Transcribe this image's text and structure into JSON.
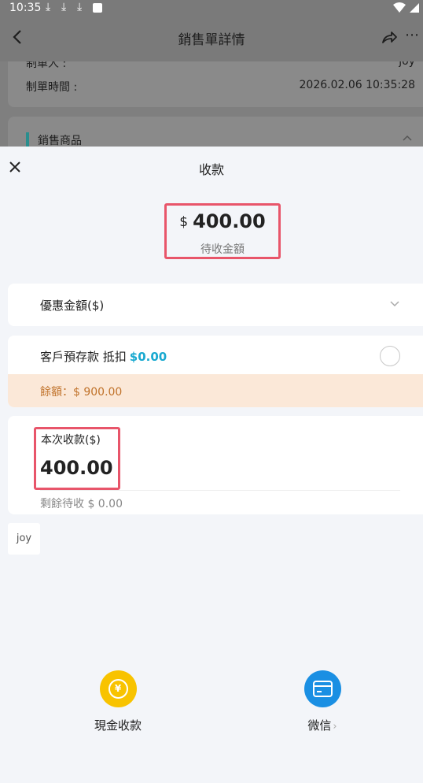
{
  "status_bar": {
    "time": "10:35"
  },
  "navbar": {
    "title": "銷售單詳情",
    "more": "⋯"
  },
  "background": {
    "creator_label": "制單人 :",
    "creator_value": "joy",
    "time_label": "制單時間 :",
    "time_value": "2026.02.06 10:35:28",
    "section_title": "銷售商品"
  },
  "sheet": {
    "title": "收款",
    "due": {
      "currency": "$",
      "amount": "400.00",
      "label": "待收金額"
    },
    "discount": {
      "label": "優惠金額($)"
    },
    "deposit": {
      "label": "客戶預存款 抵扣",
      "amount": "$0.00",
      "balance": "餘額：$ 900.00"
    },
    "payment": {
      "label": "本次收款($)",
      "amount": "400.00",
      "remaining": "剩餘待收 $ 0.00"
    },
    "tag": "joy",
    "methods": [
      {
        "label": "現金收款",
        "icon": "yuan-coin-icon",
        "color": "#f8c300",
        "glyph": "¥"
      },
      {
        "label": "微信",
        "icon": "card-icon",
        "color": "#1a8fe3",
        "arrow": "›"
      }
    ]
  },
  "colors": {
    "highlight": "#e8556a",
    "accent": "#19a9d0",
    "balance_bg": "#fbe8d8",
    "balance_text": "#c0722a"
  }
}
